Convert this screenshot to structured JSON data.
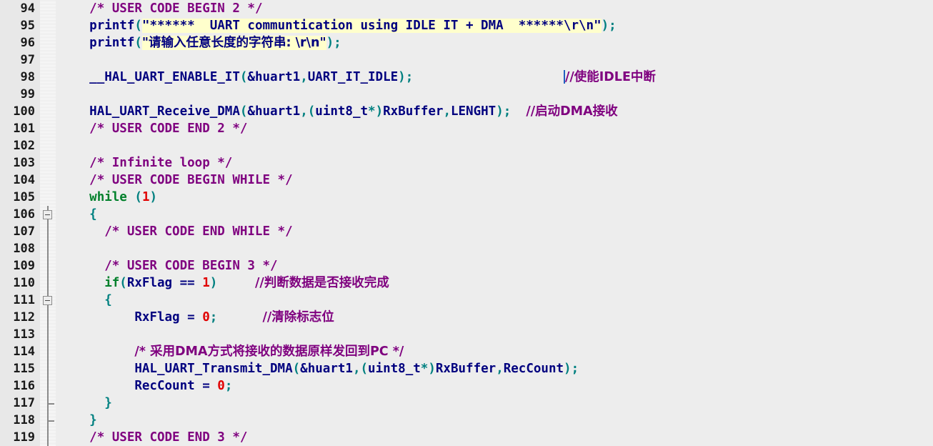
{
  "editor": {
    "background_color": "#ededed",
    "gutter_color": "#e8e8e8",
    "string_highlight_color": "#ffffcc",
    "comment_color": "#7f007f",
    "keyword_color": "#00802b",
    "number_color": "#e00000",
    "punctuation_color": "#008080",
    "identifier_color": "#00007f",
    "caret_color": "#2060c0",
    "first_line": 94,
    "last_line": 119
  },
  "lines": [
    {
      "number": "94",
      "fold": "none",
      "tokens": [
        {
          "t": "    ",
          "c": "plain"
        },
        {
          "t": "/* USER CODE BEGIN 2 */",
          "c": "cmt"
        }
      ]
    },
    {
      "number": "95",
      "fold": "none",
      "tokens": [
        {
          "t": "    ",
          "c": "plain"
        },
        {
          "t": "printf",
          "c": "ident"
        },
        {
          "t": "(",
          "c": "punct"
        },
        {
          "t": "\"******  UART communtication using IDLE IT + DMA  ******\\r\\n\"",
          "c": "str"
        },
        {
          "t": ")",
          "c": "punct"
        },
        {
          "t": ";",
          "c": "punct"
        }
      ]
    },
    {
      "number": "96",
      "fold": "none",
      "tokens": [
        {
          "t": "    ",
          "c": "plain"
        },
        {
          "t": "printf",
          "c": "ident"
        },
        {
          "t": "(",
          "c": "punct"
        },
        {
          "t": "\"请输入任意长度的字符串: \\r\\n\"",
          "c": "str-cn"
        },
        {
          "t": ")",
          "c": "punct"
        },
        {
          "t": ";",
          "c": "punct"
        }
      ]
    },
    {
      "number": "97",
      "fold": "none",
      "tokens": []
    },
    {
      "number": "98",
      "fold": "none",
      "tokens": [
        {
          "t": "    ",
          "c": "plain"
        },
        {
          "t": "__HAL_UART_ENABLE_IT",
          "c": "ident"
        },
        {
          "t": "(",
          "c": "punct"
        },
        {
          "t": "&huart1",
          "c": "ident"
        },
        {
          "t": ",",
          "c": "punct"
        },
        {
          "t": "UART_IT_IDLE",
          "c": "ident"
        },
        {
          "t": ")",
          "c": "punct"
        },
        {
          "t": ";",
          "c": "punct"
        },
        {
          "t": "                    ",
          "c": "plain"
        },
        {
          "t": "CARET",
          "c": "caret"
        },
        {
          "t": "//使能IDLE中断",
          "c": "cmt-cn"
        }
      ]
    },
    {
      "number": "99",
      "fold": "none",
      "tokens": []
    },
    {
      "number": "100",
      "fold": "none",
      "tokens": [
        {
          "t": "    ",
          "c": "plain"
        },
        {
          "t": "HAL_UART_Receive_DMA",
          "c": "ident"
        },
        {
          "t": "(",
          "c": "punct"
        },
        {
          "t": "&huart1",
          "c": "ident"
        },
        {
          "t": ",",
          "c": "punct"
        },
        {
          "t": "(",
          "c": "punct"
        },
        {
          "t": "uint8_t",
          "c": "ident"
        },
        {
          "t": "*",
          "c": "punct"
        },
        {
          "t": ")",
          "c": "punct"
        },
        {
          "t": "RxBuffer",
          "c": "ident"
        },
        {
          "t": ",",
          "c": "punct"
        },
        {
          "t": "LENGHT",
          "c": "ident"
        },
        {
          "t": ")",
          "c": "punct"
        },
        {
          "t": ";",
          "c": "punct"
        },
        {
          "t": "  ",
          "c": "plain"
        },
        {
          "t": "//启动DMA接收",
          "c": "cmt-cn"
        }
      ]
    },
    {
      "number": "101",
      "fold": "none",
      "tokens": [
        {
          "t": "    ",
          "c": "plain"
        },
        {
          "t": "/* USER CODE END 2 */",
          "c": "cmt"
        }
      ]
    },
    {
      "number": "102",
      "fold": "none",
      "tokens": []
    },
    {
      "number": "103",
      "fold": "none",
      "tokens": [
        {
          "t": "    ",
          "c": "plain"
        },
        {
          "t": "/* Infinite loop */",
          "c": "cmt"
        }
      ]
    },
    {
      "number": "104",
      "fold": "none",
      "tokens": [
        {
          "t": "    ",
          "c": "plain"
        },
        {
          "t": "/* USER CODE BEGIN WHILE */",
          "c": "cmt"
        }
      ]
    },
    {
      "number": "105",
      "fold": "none",
      "tokens": [
        {
          "t": "    ",
          "c": "plain"
        },
        {
          "t": "while",
          "c": "kw"
        },
        {
          "t": " ",
          "c": "plain"
        },
        {
          "t": "(",
          "c": "punct"
        },
        {
          "t": "1",
          "c": "num"
        },
        {
          "t": ")",
          "c": "punct"
        }
      ]
    },
    {
      "number": "106",
      "fold": "box-start",
      "tokens": [
        {
          "t": "    ",
          "c": "plain"
        },
        {
          "t": "{",
          "c": "punct"
        }
      ]
    },
    {
      "number": "107",
      "fold": "line",
      "tokens": [
        {
          "t": "      ",
          "c": "plain"
        },
        {
          "t": "/* USER CODE END WHILE */",
          "c": "cmt"
        }
      ]
    },
    {
      "number": "108",
      "fold": "line",
      "tokens": []
    },
    {
      "number": "109",
      "fold": "line",
      "tokens": [
        {
          "t": "      ",
          "c": "plain"
        },
        {
          "t": "/* USER CODE BEGIN 3 */",
          "c": "cmt"
        }
      ]
    },
    {
      "number": "110",
      "fold": "line",
      "tokens": [
        {
          "t": "      ",
          "c": "plain"
        },
        {
          "t": "if",
          "c": "kw"
        },
        {
          "t": "(",
          "c": "punct"
        },
        {
          "t": "RxFlag",
          "c": "ident"
        },
        {
          "t": " == ",
          "c": "ident"
        },
        {
          "t": "1",
          "c": "num"
        },
        {
          "t": ")",
          "c": "punct"
        },
        {
          "t": "     ",
          "c": "plain"
        },
        {
          "t": "//判断数据是否接收完成",
          "c": "cmt-cn"
        }
      ]
    },
    {
      "number": "111",
      "fold": "box-start",
      "tokens": [
        {
          "t": "      ",
          "c": "plain"
        },
        {
          "t": "{",
          "c": "punct"
        }
      ]
    },
    {
      "number": "112",
      "fold": "line",
      "tokens": [
        {
          "t": "          ",
          "c": "plain"
        },
        {
          "t": "RxFlag",
          "c": "ident"
        },
        {
          "t": " = ",
          "c": "ident"
        },
        {
          "t": "0",
          "c": "num"
        },
        {
          "t": ";",
          "c": "punct"
        },
        {
          "t": "      ",
          "c": "plain"
        },
        {
          "t": "//清除标志位",
          "c": "cmt-cn"
        }
      ]
    },
    {
      "number": "113",
      "fold": "line",
      "tokens": []
    },
    {
      "number": "114",
      "fold": "line",
      "tokens": [
        {
          "t": "          ",
          "c": "plain"
        },
        {
          "t": "/* 采用DMA方式将接收的数据原样发回到PC */",
          "c": "cmt-cn"
        }
      ]
    },
    {
      "number": "115",
      "fold": "line",
      "tokens": [
        {
          "t": "          ",
          "c": "plain"
        },
        {
          "t": "HAL_UART_Transmit_DMA",
          "c": "ident"
        },
        {
          "t": "(",
          "c": "punct"
        },
        {
          "t": "&huart1",
          "c": "ident"
        },
        {
          "t": ",",
          "c": "punct"
        },
        {
          "t": "(",
          "c": "punct"
        },
        {
          "t": "uint8_t",
          "c": "ident"
        },
        {
          "t": "*",
          "c": "punct"
        },
        {
          "t": ")",
          "c": "punct"
        },
        {
          "t": "RxBuffer",
          "c": "ident"
        },
        {
          "t": ",",
          "c": "punct"
        },
        {
          "t": "RecCount",
          "c": "ident"
        },
        {
          "t": ")",
          "c": "punct"
        },
        {
          "t": ";",
          "c": "punct"
        }
      ]
    },
    {
      "number": "116",
      "fold": "line",
      "tokens": [
        {
          "t": "          ",
          "c": "plain"
        },
        {
          "t": "RecCount",
          "c": "ident"
        },
        {
          "t": " = ",
          "c": "ident"
        },
        {
          "t": "0",
          "c": "num"
        },
        {
          "t": ";",
          "c": "punct"
        }
      ]
    },
    {
      "number": "117",
      "fold": "tick",
      "tokens": [
        {
          "t": "      ",
          "c": "plain"
        },
        {
          "t": "}",
          "c": "punct"
        }
      ]
    },
    {
      "number": "118",
      "fold": "tick",
      "tokens": [
        {
          "t": "    ",
          "c": "plain"
        },
        {
          "t": "}",
          "c": "punct"
        }
      ]
    },
    {
      "number": "119",
      "fold": "line",
      "tokens": [
        {
          "t": "    ",
          "c": "plain"
        },
        {
          "t": "/* USER CODE END 3 */",
          "c": "cmt"
        }
      ]
    }
  ]
}
